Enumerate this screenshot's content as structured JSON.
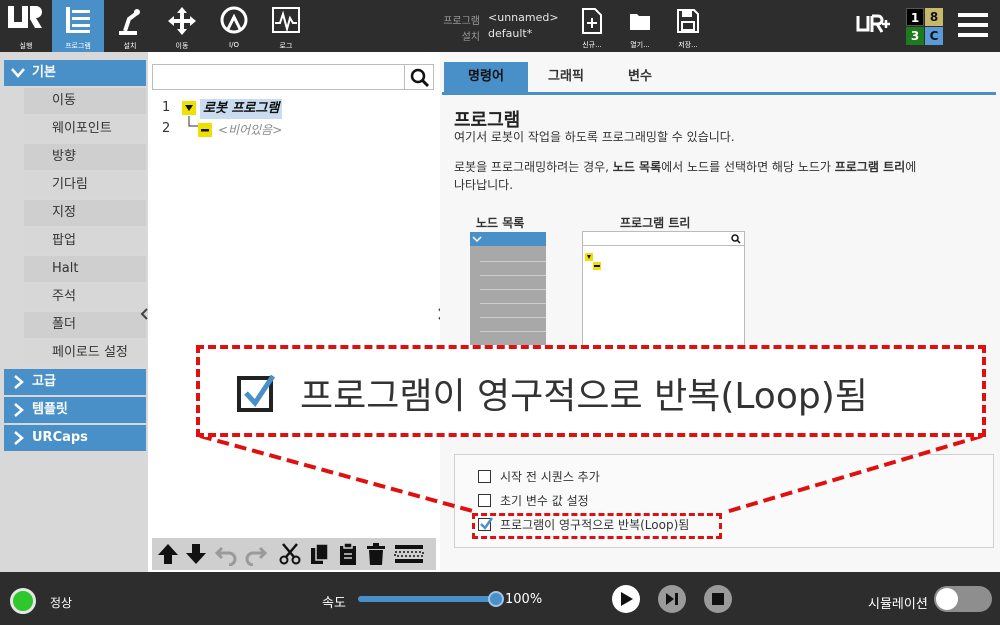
{
  "topbar": {
    "tabs": [
      {
        "label": "실행",
        "icon": "logo-icon"
      },
      {
        "label": "프로그램",
        "icon": "program-icon"
      },
      {
        "label": "설치",
        "icon": "robot-arm-icon"
      },
      {
        "label": "이동",
        "icon": "move-arrows-icon"
      },
      {
        "label": "I/O",
        "icon": "io-icon"
      },
      {
        "label": "로그",
        "icon": "log-icon"
      }
    ],
    "program_label": "프로그램",
    "program_value": "<unnamed>",
    "install_label": "설치",
    "install_value": "default*",
    "new_label": "신규...",
    "open_label": "열기...",
    "save_label": "저장...",
    "io_numbers": [
      "1",
      "8",
      "3",
      "C"
    ]
  },
  "nodes": {
    "basic_header": "기본",
    "items": [
      "이동",
      "웨이포인트",
      "방향",
      "기다림",
      "지정",
      "팝업",
      "Halt",
      "주석",
      "폴더",
      "페이로드 설정"
    ],
    "advanced_header": "고급",
    "template_header": "템플릿",
    "urcaps_header": "URCaps"
  },
  "tree": {
    "line1": "1",
    "line2": "2",
    "root_label": "로봇 프로그램",
    "empty_label": "<비어있음>"
  },
  "right": {
    "tabs": [
      "명령어",
      "그래픽",
      "변수"
    ],
    "title": "프로그램",
    "desc1": "여기서 로봇이 작업을 하도록 프로그래밍할 수 있습니다.",
    "desc2_a": "로봇을 프로그래밍하려는 경우, ",
    "desc2_b": "노드 목록",
    "desc2_c": "에서 노드를 선택하면 해당 노드가 ",
    "desc2_d": "프로그램 트리",
    "desc2_e": "에",
    "desc2_f": "나타납니다.",
    "diagram_node_list": "노드 목록",
    "diagram_program_tree": "프로그램 트리",
    "check1": "시작 전 시퀀스 추가",
    "check2": "초기 변수 값 설정",
    "check3": "프로그램이 영구적으로 반복(Loop)됨"
  },
  "callout": {
    "text": "프로그램이 영구적으로 반복(Loop)됨"
  },
  "footer": {
    "status": "정상",
    "speed_label": "속도",
    "speed_value": "100%",
    "speed_fraction": 1.0,
    "sim_label": "시뮬레이션",
    "sim_on": false
  },
  "colors": {
    "accent": "#4a90c8",
    "topbar": "#2d2d2d",
    "callout_border": "#e01010",
    "status_green": "#2ec82e",
    "io_black": "#000000",
    "io_gold": "#c8b86a",
    "io_green": "#1e7a1e",
    "io_blue": "#5a9ad6"
  }
}
